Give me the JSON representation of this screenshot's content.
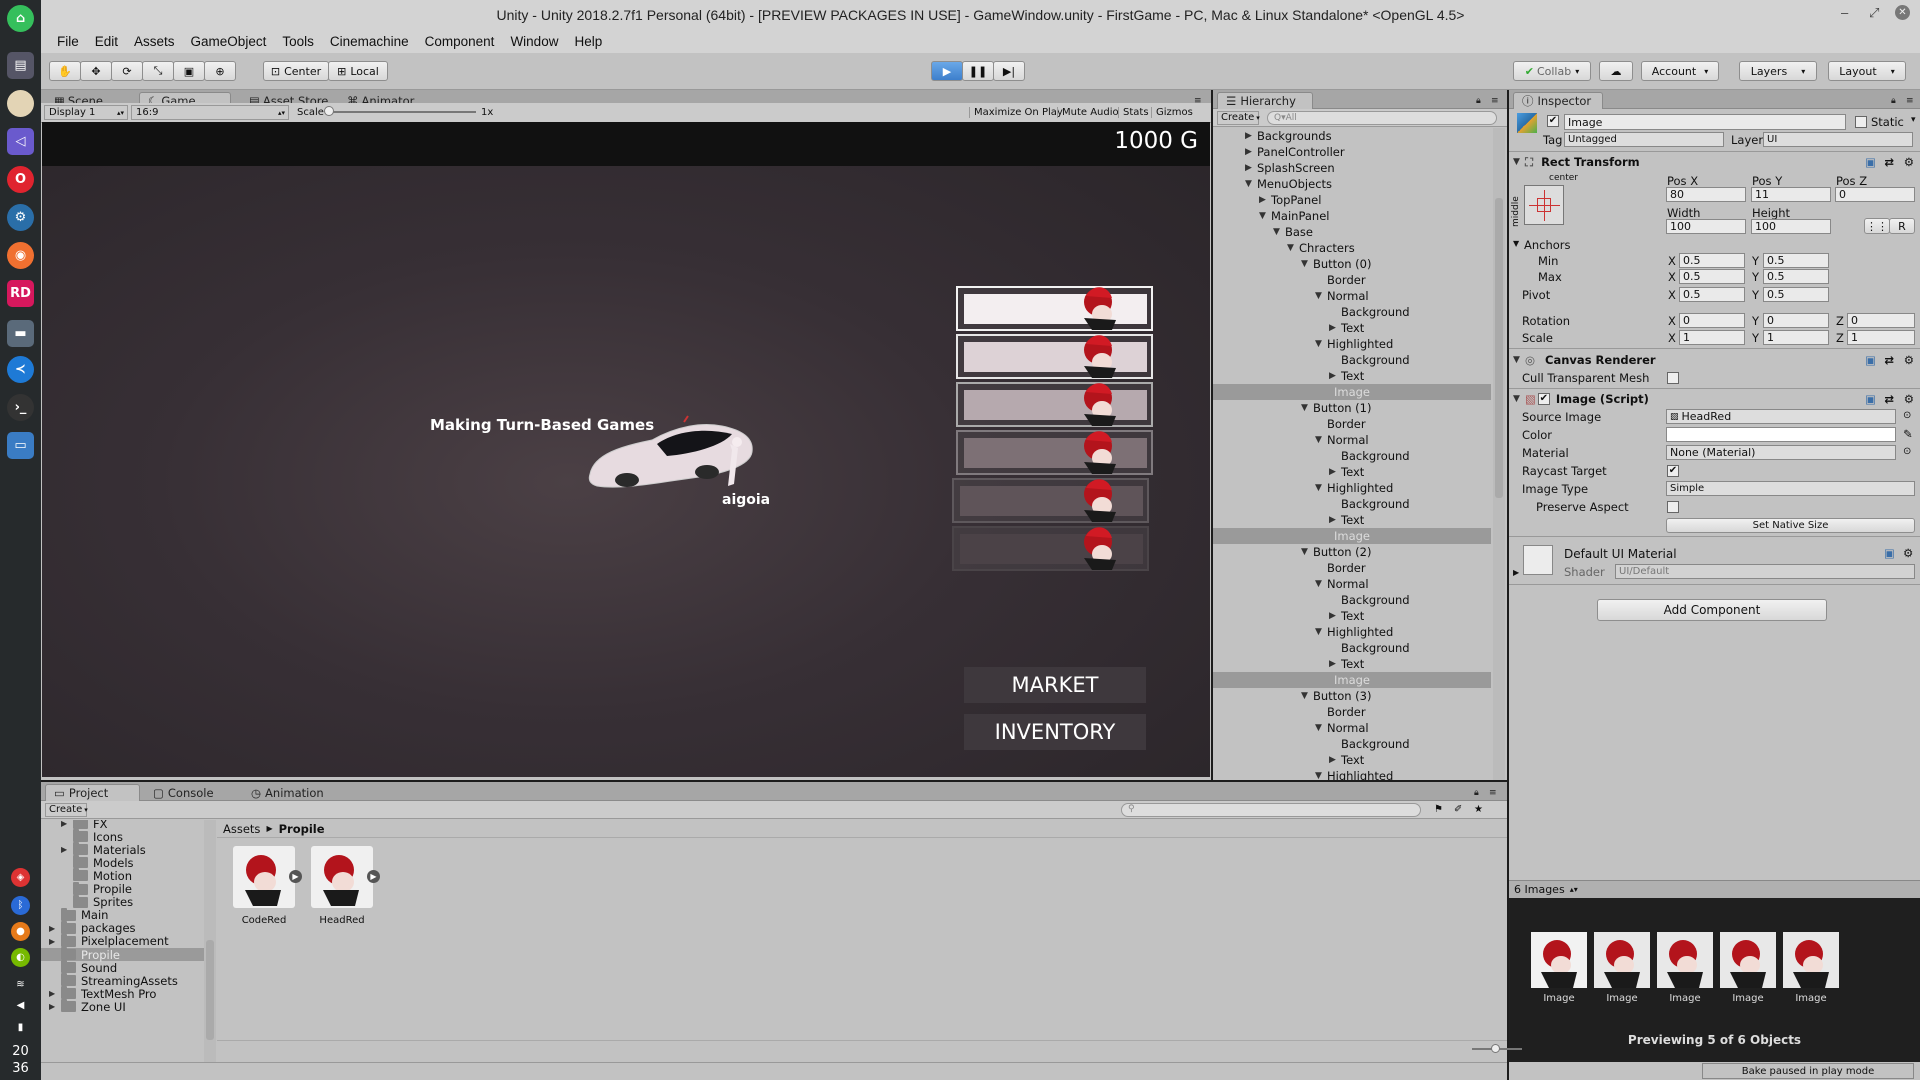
{
  "window": {
    "title": "Unity - Unity 2018.2.7f1 Personal (64bit) - [PREVIEW PACKAGES IN USE] - GameWindow.unity - FirstGame - PC, Mac & Linux Standalone* <OpenGL 4.5>"
  },
  "dock": {
    "clock_hour": "20",
    "clock_min": "36"
  },
  "menu": [
    "File",
    "Edit",
    "Assets",
    "GameObject",
    "Tools",
    "Cinemachine",
    "Component",
    "Window",
    "Help"
  ],
  "toolbar": {
    "center": "Center",
    "local": "Local",
    "collab": "Collab",
    "account": "Account",
    "layers": "Layers",
    "layout": "Layout"
  },
  "scene_tabs": {
    "scene": "Scene",
    "game": "Game",
    "asset_store": "Asset Store",
    "animator": "Animator"
  },
  "game_bar": {
    "display": "Display 1",
    "aspect": "16:9",
    "scale_label": "Scale",
    "scale_value": "1x",
    "maximize": "Maximize On Play",
    "mute": "Mute Audio",
    "stats": "Stats",
    "gizmos": "Gizmos"
  },
  "game": {
    "gold": "1000 G",
    "tagline": "Making Turn-Based Games",
    "author": "aigoia",
    "market": "MARKET",
    "inventory": "INVENTORY"
  },
  "hierarchy": {
    "tab": "Hierarchy",
    "create": "Create",
    "search_placeholder": "Q▾All",
    "rows": [
      {
        "label": "Backgrounds",
        "indent": 0,
        "arrow": "right"
      },
      {
        "label": "PanelController",
        "indent": 0,
        "arrow": "right"
      },
      {
        "label": "SplashScreen",
        "indent": 0,
        "arrow": "right"
      },
      {
        "label": "MenuObjects",
        "indent": 0,
        "arrow": "down"
      },
      {
        "label": "TopPanel",
        "indent": 1,
        "arrow": "right"
      },
      {
        "label": "MainPanel",
        "indent": 1,
        "arrow": "down"
      },
      {
        "label": "Base",
        "indent": 2,
        "arrow": "down"
      },
      {
        "label": "Chracters",
        "indent": 3,
        "arrow": "down"
      },
      {
        "label": "Button (0)",
        "indent": 4,
        "arrow": "down"
      },
      {
        "label": "Border",
        "indent": 5,
        "arrow": ""
      },
      {
        "label": "Normal",
        "indent": 5,
        "arrow": "down"
      },
      {
        "label": "Background",
        "indent": 6,
        "arrow": ""
      },
      {
        "label": "Text",
        "indent": 6,
        "arrow": "right"
      },
      {
        "label": "Highlighted",
        "indent": 5,
        "arrow": "down"
      },
      {
        "label": "Background",
        "indent": 6,
        "arrow": ""
      },
      {
        "label": "Text",
        "indent": 6,
        "arrow": "right"
      },
      {
        "label": "Image",
        "indent": 5,
        "arrow": "",
        "selected": true
      },
      {
        "label": "Button (1)",
        "indent": 4,
        "arrow": "down"
      },
      {
        "label": "Border",
        "indent": 5,
        "arrow": ""
      },
      {
        "label": "Normal",
        "indent": 5,
        "arrow": "down"
      },
      {
        "label": "Background",
        "indent": 6,
        "arrow": ""
      },
      {
        "label": "Text",
        "indent": 6,
        "arrow": "right"
      },
      {
        "label": "Highlighted",
        "indent": 5,
        "arrow": "down"
      },
      {
        "label": "Background",
        "indent": 6,
        "arrow": ""
      },
      {
        "label": "Text",
        "indent": 6,
        "arrow": "right"
      },
      {
        "label": "Image",
        "indent": 5,
        "arrow": "",
        "selected": true
      },
      {
        "label": "Button (2)",
        "indent": 4,
        "arrow": "down"
      },
      {
        "label": "Border",
        "indent": 5,
        "arrow": ""
      },
      {
        "label": "Normal",
        "indent": 5,
        "arrow": "down"
      },
      {
        "label": "Background",
        "indent": 6,
        "arrow": ""
      },
      {
        "label": "Text",
        "indent": 6,
        "arrow": "right"
      },
      {
        "label": "Highlighted",
        "indent": 5,
        "arrow": "down"
      },
      {
        "label": "Background",
        "indent": 6,
        "arrow": ""
      },
      {
        "label": "Text",
        "indent": 6,
        "arrow": "right"
      },
      {
        "label": "Image",
        "indent": 5,
        "arrow": "",
        "selected": true
      },
      {
        "label": "Button (3)",
        "indent": 4,
        "arrow": "down"
      },
      {
        "label": "Border",
        "indent": 5,
        "arrow": ""
      },
      {
        "label": "Normal",
        "indent": 5,
        "arrow": "down"
      },
      {
        "label": "Background",
        "indent": 6,
        "arrow": ""
      },
      {
        "label": "Text",
        "indent": 6,
        "arrow": "right"
      },
      {
        "label": "Highlighted",
        "indent": 5,
        "arrow": "down"
      }
    ]
  },
  "inspector": {
    "tab": "Inspector",
    "name": "Image",
    "static": "Static",
    "tag_label": "Tag",
    "tag": "Untagged",
    "layer_label": "Layer",
    "layer": "UI",
    "rect_transform": "Rect Transform",
    "anchor_h": "center",
    "anchor_v": "middle",
    "posx_l": "Pos X",
    "posy_l": "Pos Y",
    "posz_l": "Pos Z",
    "posx": "80",
    "posy": "11",
    "posz": "0",
    "width_l": "Width",
    "height_l": "Height",
    "width": "100",
    "height": "100",
    "r_btn": "R",
    "anchors": "Anchors",
    "min": "Min",
    "max": "Max",
    "pivot": "Pivot",
    "rotation": "Rotation",
    "scale": "Scale",
    "x": "X",
    "y": "Y",
    "z": "Z",
    "min_x": "0.5",
    "min_y": "0.5",
    "max_x": "0.5",
    "max_y": "0.5",
    "pivot_x": "0.5",
    "pivot_y": "0.5",
    "rot_x": "0",
    "rot_y": "0",
    "rot_z": "0",
    "scale_x": "1",
    "scale_y": "1",
    "scale_z": "1",
    "canvas_renderer": "Canvas Renderer",
    "cull": "Cull Transparent Mesh",
    "image_script": "Image (Script)",
    "source_image_l": "Source Image",
    "source_image": "HeadRed",
    "color_l": "Color",
    "material_l": "Material",
    "material": "None (Material)",
    "raycast_l": "Raycast Target",
    "image_type_l": "Image Type",
    "image_type": "Simple",
    "preserve_l": "Preserve Aspect",
    "set_native": "Set Native Size",
    "default_mat": "Default UI Material",
    "shader_l": "Shader",
    "shader": "UI/Default",
    "add_component": "Add Component",
    "preview_title": "6 Images",
    "preview_caption": "Previewing 5 of 6 Objects",
    "preview_labels": [
      "Image",
      "Image",
      "Image",
      "Image",
      "Image"
    ]
  },
  "project": {
    "tabs": {
      "project": "Project",
      "console": "Console",
      "animation": "Animation"
    },
    "create": "Create",
    "breadcrumb_root": "Assets",
    "breadcrumb_current": "Propile",
    "folders": [
      {
        "label": "FX",
        "indent": 1,
        "arrow": "right"
      },
      {
        "label": "Icons",
        "indent": 1,
        "arrow": ""
      },
      {
        "label": "Materials",
        "indent": 1,
        "arrow": "right"
      },
      {
        "label": "Models",
        "indent": 1,
        "arrow": ""
      },
      {
        "label": "Motion",
        "indent": 1,
        "arrow": ""
      },
      {
        "label": "Propile",
        "indent": 1,
        "arrow": ""
      },
      {
        "label": "Sprites",
        "indent": 1,
        "arrow": ""
      },
      {
        "label": "Main",
        "indent": 0,
        "arrow": ""
      },
      {
        "label": "packages",
        "indent": 0,
        "arrow": "right"
      },
      {
        "label": "Pixelplacement",
        "indent": 0,
        "arrow": "right"
      },
      {
        "label": "Propile",
        "indent": 0,
        "arrow": "",
        "selected": true
      },
      {
        "label": "Sound",
        "indent": 0,
        "arrow": ""
      },
      {
        "label": "StreamingAssets",
        "indent": 0,
        "arrow": ""
      },
      {
        "label": "TextMesh Pro",
        "indent": 0,
        "arrow": "right"
      },
      {
        "label": "Zone UI",
        "indent": 0,
        "arrow": "right"
      }
    ],
    "assets": [
      "CodeRed",
      "HeadRed"
    ]
  },
  "status": {
    "bake": "Bake paused in play mode"
  },
  "colors": {
    "play_active": "#4a90d9",
    "panel_bg": "#c2c2c2",
    "selection": "#9a9a9a"
  }
}
